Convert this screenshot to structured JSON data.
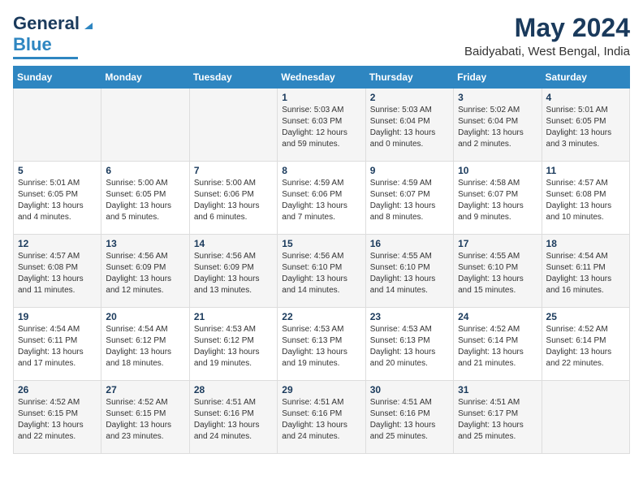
{
  "header": {
    "logo_general": "General",
    "logo_blue": "Blue",
    "month_title": "May 2024",
    "location": "Baidyabati, West Bengal, India"
  },
  "days_of_week": [
    "Sunday",
    "Monday",
    "Tuesday",
    "Wednesday",
    "Thursday",
    "Friday",
    "Saturday"
  ],
  "weeks": [
    {
      "cells": [
        {
          "day": "",
          "content": ""
        },
        {
          "day": "",
          "content": ""
        },
        {
          "day": "",
          "content": ""
        },
        {
          "day": "1",
          "content": "Sunrise: 5:03 AM\nSunset: 6:03 PM\nDaylight: 12 hours\nand 59 minutes."
        },
        {
          "day": "2",
          "content": "Sunrise: 5:03 AM\nSunset: 6:04 PM\nDaylight: 13 hours\nand 0 minutes."
        },
        {
          "day": "3",
          "content": "Sunrise: 5:02 AM\nSunset: 6:04 PM\nDaylight: 13 hours\nand 2 minutes."
        },
        {
          "day": "4",
          "content": "Sunrise: 5:01 AM\nSunset: 6:05 PM\nDaylight: 13 hours\nand 3 minutes."
        }
      ]
    },
    {
      "cells": [
        {
          "day": "5",
          "content": "Sunrise: 5:01 AM\nSunset: 6:05 PM\nDaylight: 13 hours\nand 4 minutes."
        },
        {
          "day": "6",
          "content": "Sunrise: 5:00 AM\nSunset: 6:05 PM\nDaylight: 13 hours\nand 5 minutes."
        },
        {
          "day": "7",
          "content": "Sunrise: 5:00 AM\nSunset: 6:06 PM\nDaylight: 13 hours\nand 6 minutes."
        },
        {
          "day": "8",
          "content": "Sunrise: 4:59 AM\nSunset: 6:06 PM\nDaylight: 13 hours\nand 7 minutes."
        },
        {
          "day": "9",
          "content": "Sunrise: 4:59 AM\nSunset: 6:07 PM\nDaylight: 13 hours\nand 8 minutes."
        },
        {
          "day": "10",
          "content": "Sunrise: 4:58 AM\nSunset: 6:07 PM\nDaylight: 13 hours\nand 9 minutes."
        },
        {
          "day": "11",
          "content": "Sunrise: 4:57 AM\nSunset: 6:08 PM\nDaylight: 13 hours\nand 10 minutes."
        }
      ]
    },
    {
      "cells": [
        {
          "day": "12",
          "content": "Sunrise: 4:57 AM\nSunset: 6:08 PM\nDaylight: 13 hours\nand 11 minutes."
        },
        {
          "day": "13",
          "content": "Sunrise: 4:56 AM\nSunset: 6:09 PM\nDaylight: 13 hours\nand 12 minutes."
        },
        {
          "day": "14",
          "content": "Sunrise: 4:56 AM\nSunset: 6:09 PM\nDaylight: 13 hours\nand 13 minutes."
        },
        {
          "day": "15",
          "content": "Sunrise: 4:56 AM\nSunset: 6:10 PM\nDaylight: 13 hours\nand 14 minutes."
        },
        {
          "day": "16",
          "content": "Sunrise: 4:55 AM\nSunset: 6:10 PM\nDaylight: 13 hours\nand 14 minutes."
        },
        {
          "day": "17",
          "content": "Sunrise: 4:55 AM\nSunset: 6:10 PM\nDaylight: 13 hours\nand 15 minutes."
        },
        {
          "day": "18",
          "content": "Sunrise: 4:54 AM\nSunset: 6:11 PM\nDaylight: 13 hours\nand 16 minutes."
        }
      ]
    },
    {
      "cells": [
        {
          "day": "19",
          "content": "Sunrise: 4:54 AM\nSunset: 6:11 PM\nDaylight: 13 hours\nand 17 minutes."
        },
        {
          "day": "20",
          "content": "Sunrise: 4:54 AM\nSunset: 6:12 PM\nDaylight: 13 hours\nand 18 minutes."
        },
        {
          "day": "21",
          "content": "Sunrise: 4:53 AM\nSunset: 6:12 PM\nDaylight: 13 hours\nand 19 minutes."
        },
        {
          "day": "22",
          "content": "Sunrise: 4:53 AM\nSunset: 6:13 PM\nDaylight: 13 hours\nand 19 minutes."
        },
        {
          "day": "23",
          "content": "Sunrise: 4:53 AM\nSunset: 6:13 PM\nDaylight: 13 hours\nand 20 minutes."
        },
        {
          "day": "24",
          "content": "Sunrise: 4:52 AM\nSunset: 6:14 PM\nDaylight: 13 hours\nand 21 minutes."
        },
        {
          "day": "25",
          "content": "Sunrise: 4:52 AM\nSunset: 6:14 PM\nDaylight: 13 hours\nand 22 minutes."
        }
      ]
    },
    {
      "cells": [
        {
          "day": "26",
          "content": "Sunrise: 4:52 AM\nSunset: 6:15 PM\nDaylight: 13 hours\nand 22 minutes."
        },
        {
          "day": "27",
          "content": "Sunrise: 4:52 AM\nSunset: 6:15 PM\nDaylight: 13 hours\nand 23 minutes."
        },
        {
          "day": "28",
          "content": "Sunrise: 4:51 AM\nSunset: 6:16 PM\nDaylight: 13 hours\nand 24 minutes."
        },
        {
          "day": "29",
          "content": "Sunrise: 4:51 AM\nSunset: 6:16 PM\nDaylight: 13 hours\nand 24 minutes."
        },
        {
          "day": "30",
          "content": "Sunrise: 4:51 AM\nSunset: 6:16 PM\nDaylight: 13 hours\nand 25 minutes."
        },
        {
          "day": "31",
          "content": "Sunrise: 4:51 AM\nSunset: 6:17 PM\nDaylight: 13 hours\nand 25 minutes."
        },
        {
          "day": "",
          "content": ""
        }
      ]
    }
  ]
}
